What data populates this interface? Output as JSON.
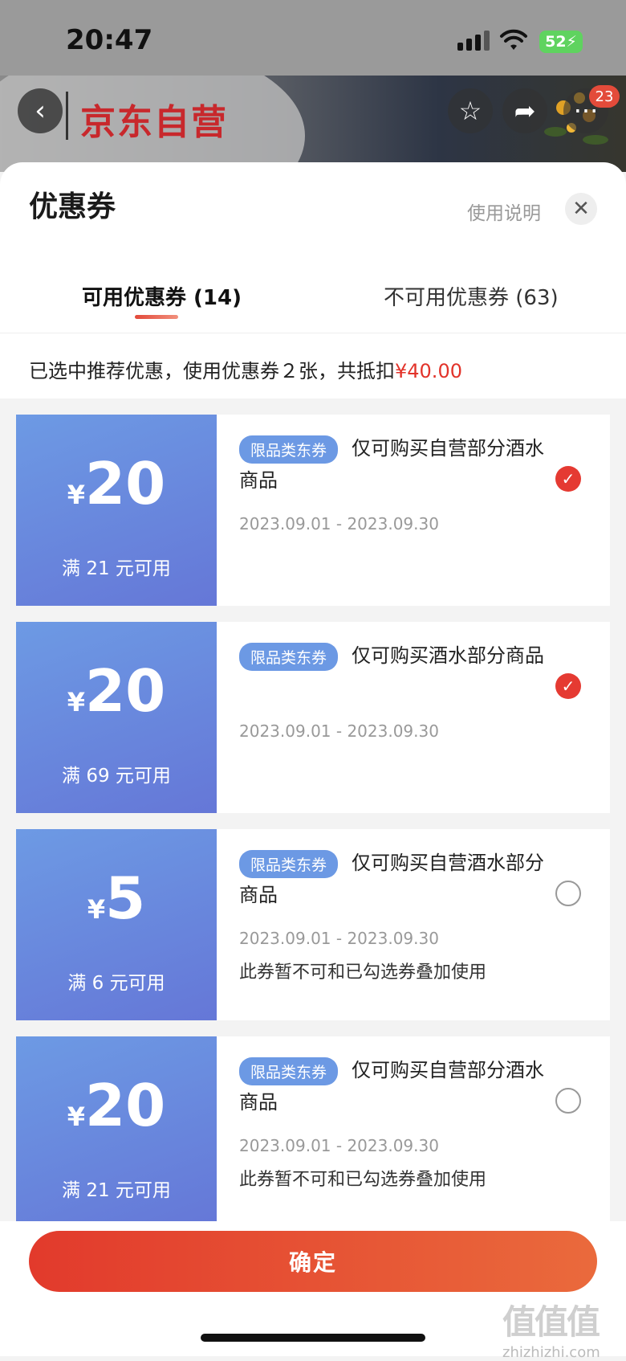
{
  "status": {
    "time": "20:47",
    "battery": "52"
  },
  "header": {
    "store_name": "京东自营",
    "badge_count": "23"
  },
  "sheet": {
    "title": "优惠券",
    "help": "使用说明"
  },
  "tabs": [
    {
      "label": "可用优惠券 (14)",
      "active": true
    },
    {
      "label": "不可用优惠券 (63)",
      "active": false
    }
  ],
  "summary": {
    "text": "已选中推荐优惠，使用优惠券２张，共抵扣",
    "amount": "¥40.00"
  },
  "coupons": [
    {
      "yen": "¥",
      "amount": "20",
      "condition": "满 21 元可用",
      "tag": "限品类东券",
      "desc": "仅可购买自营部分酒水商品",
      "date": "2023.09.01 - 2023.09.30",
      "note": "",
      "selected": true
    },
    {
      "yen": "¥",
      "amount": "20",
      "condition": "满 69 元可用",
      "tag": "限品类东券",
      "desc": "仅可购买酒水部分商品",
      "date": "2023.09.01 - 2023.09.30",
      "note": "",
      "selected": true
    },
    {
      "yen": "¥",
      "amount": "5",
      "condition": "满 6 元可用",
      "tag": "限品类东券",
      "desc": "仅可购买自营酒水部分商品",
      "date": "2023.09.01 - 2023.09.30",
      "note": "此券暂不可和已勾选券叠加使用",
      "selected": false
    },
    {
      "yen": "¥",
      "amount": "20",
      "condition": "满 21 元可用",
      "tag": "限品类东券",
      "desc": "仅可购买自营部分酒水商品",
      "date": "2023.09.01 - 2023.09.30",
      "note": "此券暂不可和已勾选券叠加使用",
      "selected": false
    }
  ],
  "footer": {
    "confirm": "确定",
    "watermark": "值值值",
    "watermark_url": "zhizhizhi.com"
  }
}
